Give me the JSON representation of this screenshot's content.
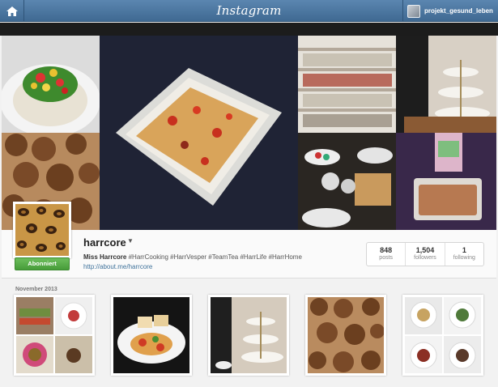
{
  "topbar": {
    "brand": "Instagram",
    "home_icon": "home-icon",
    "username": "projekt_gesund_leben"
  },
  "profile": {
    "username": "harrcore",
    "caret_icon": "chevron-down-icon",
    "full_name": "Miss Harrcore",
    "bio_tags": "#HarrCooking #HarrVesper #TeamTea #HarrLife #HarrHome",
    "website": "http://about.me/harrcore",
    "follow_button": "Abonniert",
    "stats": [
      {
        "value": "848",
        "label": "posts"
      },
      {
        "value": "1,504",
        "label": "followers"
      },
      {
        "value": "1",
        "label": "following"
      }
    ]
  },
  "feed": {
    "month": "November 2013"
  },
  "colors": {
    "header": "#4c7aa5",
    "follow_green": "#54ab45",
    "link": "#3f729b"
  }
}
